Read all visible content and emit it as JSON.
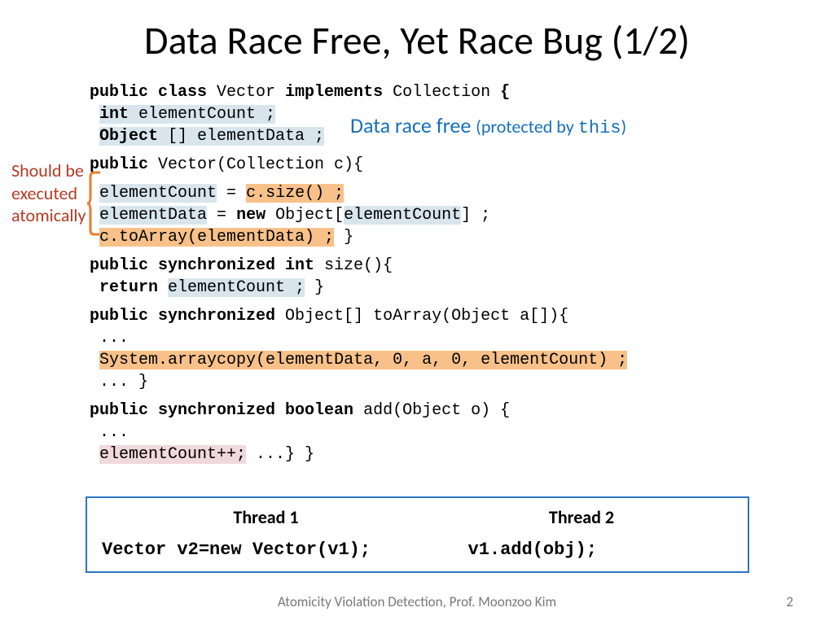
{
  "title": "Data Race Free, Yet Race Bug (1/2)",
  "annotation": "Should be executed atomically",
  "dataRaceFree": {
    "main": "Data race free",
    "sub1": "(protected by ",
    "mono": "this",
    "sub2": ")"
  },
  "code": {
    "l1_a": "public class ",
    "l1_b": "Vector ",
    "l1_c": "implements ",
    "l1_d": "Collection ",
    "l1_e": "{",
    "l2_a": "int ",
    "l2_b": "elementCount ;",
    "l3_a": "Object ",
    "l3_b": "[] elementData ;",
    "l4_a": "public ",
    "l4_b": "Vector(Collection c){",
    "l5_a": "elementCount",
    "l5_b": " = ",
    "l5_c": "c.size() ;",
    "l6_a": "elementData",
    "l6_b": " = ",
    "l6_c": "new ",
    "l6_d": "Object[",
    "l6_e": "elementCount",
    "l6_f": "] ;",
    "l7_a": "c.toArray(elementData) ;",
    "l7_b": " }",
    "l8_a": "public synchronized int ",
    "l8_b": "size(){",
    "l9_a": "return ",
    "l9_b": "elementCount ;",
    "l9_c": " }",
    "l10_a": "public synchronized ",
    "l10_b": "Object[] toArray(Object a[]){",
    "l11": "...",
    "l12": "System.arraycopy(elementData, 0, a, 0, elementCount) ;",
    "l13": "... }",
    "l14_a": "public synchronized boolean ",
    "l14_b": "add(Object o) {",
    "l15": "...",
    "l16_a": "elementCount++;",
    "l16_b": " ...} }"
  },
  "threads": {
    "h1": "Thread 1",
    "h2": "Thread 2",
    "c1": "Vector v2=new Vector(v1);",
    "c2": "v1.add(obj);"
  },
  "footer": "Atomicity Violation Detection, Prof. Moonzoo Kim",
  "pageNum": "2"
}
